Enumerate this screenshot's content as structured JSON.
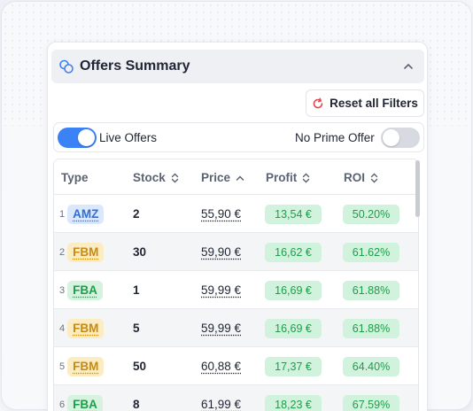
{
  "panel": {
    "title": "Offers Summary",
    "reset_label": "Reset all Filters"
  },
  "filters": {
    "live_offers": {
      "label": "Live Offers",
      "on": true
    },
    "no_prime_offer": {
      "label": "No Prime Offer",
      "on": false
    }
  },
  "table": {
    "headers": {
      "type": "Type",
      "stock": "Stock",
      "price": "Price",
      "profit": "Profit",
      "roi": "ROI"
    },
    "rows": [
      {
        "index": "1",
        "type": "AMZ",
        "stock": "2",
        "price": "55,90 €",
        "profit": "13,54 €",
        "roi": "50.20%"
      },
      {
        "index": "2",
        "type": "FBM",
        "stock": "30",
        "price": "59,90 €",
        "profit": "16,62 €",
        "roi": "61.62%"
      },
      {
        "index": "3",
        "type": "FBA",
        "stock": "1",
        "price": "59,99 €",
        "profit": "16,69 €",
        "roi": "61.88%"
      },
      {
        "index": "4",
        "type": "FBM",
        "stock": "5",
        "price": "59,99 €",
        "profit": "16,69 €",
        "roi": "61.88%"
      },
      {
        "index": "5",
        "type": "FBM",
        "stock": "50",
        "price": "60,88 €",
        "profit": "17,37 €",
        "roi": "64.40%"
      },
      {
        "index": "6",
        "type": "FBA",
        "stock": "8",
        "price": "61,99 €",
        "profit": "18,23 €",
        "roi": "67.59%"
      }
    ]
  },
  "colors": {
    "AMZ": {
      "bg": "#dbe8fb",
      "fg": "#2f6fd6"
    },
    "FBM": {
      "bg": "#fbecc2",
      "fg": "#c88a12"
    },
    "FBA": {
      "bg": "#d6f3df",
      "fg": "#1f9d4a"
    }
  },
  "icons": {
    "header": "coins-icon",
    "collapse": "chevron-up-icon",
    "reset": "refresh-icon",
    "sort": "sort-icon",
    "sort_active": "sort-asc-icon"
  }
}
